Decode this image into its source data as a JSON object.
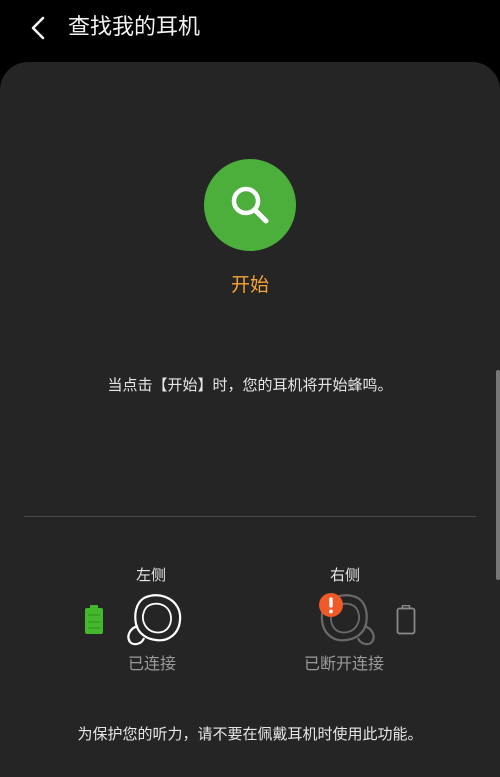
{
  "header": {
    "title": "查找我的耳机",
    "back_icon": "chevron-left-icon"
  },
  "main": {
    "start_icon": "search-icon",
    "start_button_color": "#4caf3c",
    "start_label": "开始",
    "start_label_color": "#f5a33a",
    "hint": "当点击【开始】时，您的耳机将开始蜂鸣。"
  },
  "left_earbud": {
    "label": "左侧",
    "status": "已连接",
    "battery_icon": "battery-full-icon",
    "battery_color": "#44b82c"
  },
  "right_earbud": {
    "label": "右侧",
    "status": "已断开连接",
    "alert_icon": "warning-icon",
    "alert_color": "#f05a28",
    "battery_icon": "battery-empty-icon"
  },
  "footer": {
    "note": "为保护您的听力，请不要在佩戴耳机时使用此功能。"
  }
}
